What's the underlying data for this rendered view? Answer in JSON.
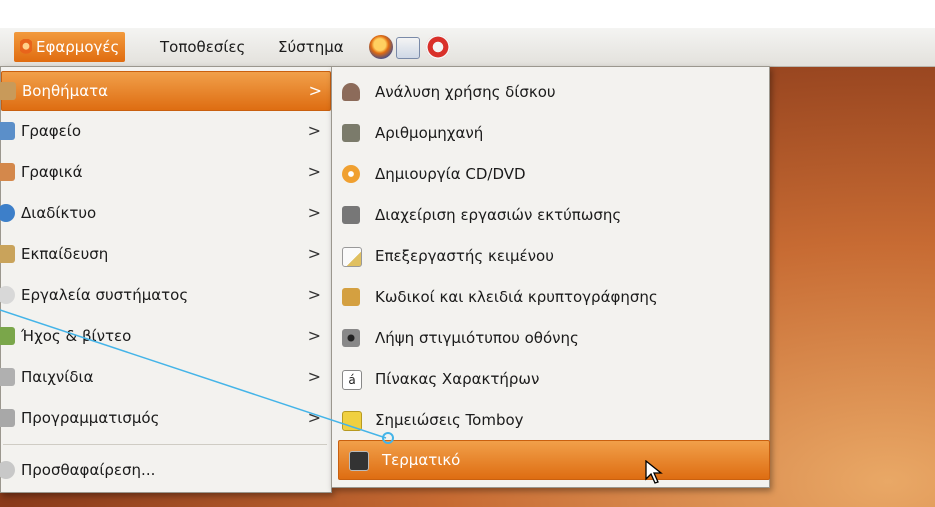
{
  "panel": {
    "menus": [
      "Εφαρμογές",
      "Τοποθεσίες",
      "Σύστημα"
    ],
    "launchers": [
      "firefox-icon",
      "mail-icon",
      "help-icon"
    ]
  },
  "apps_menu": {
    "items": [
      {
        "label": "Βοηθήματα",
        "icon": "accessories-icon",
        "color": "#c89a5a",
        "highlighted": true
      },
      {
        "label": "Γραφείο",
        "icon": "office-icon",
        "color": "#5b8fc9"
      },
      {
        "label": "Γραφικά",
        "icon": "graphics-icon",
        "color": "#d4884b"
      },
      {
        "label": "Διαδίκτυο",
        "icon": "internet-icon",
        "color": "#3d7fc9"
      },
      {
        "label": "Εκπαίδευση",
        "icon": "education-icon",
        "color": "#c9a35b"
      },
      {
        "label": "Εργαλεία συστήματος",
        "icon": "system-tools-icon",
        "color": "#b8b8b8"
      },
      {
        "label": "Ήχος & βίντεο",
        "icon": "sound-video-icon",
        "color": "#7aa64a"
      },
      {
        "label": "Παιχνίδια",
        "icon": "games-icon",
        "color": "#999999"
      },
      {
        "label": "Προγραμματισμός",
        "icon": "programming-icon",
        "color": "#999999"
      },
      {
        "label": "Προσθαφαίρεση...",
        "icon": "add-remove-icon",
        "color": "#888888"
      }
    ]
  },
  "accessories_menu": {
    "items": [
      {
        "label": "Ανάλυση χρήσης δίσκου",
        "icon": "disk-usage-icon",
        "color": "#8c6b5a"
      },
      {
        "label": "Αριθμομηχανή",
        "icon": "calculator-icon",
        "color": "#7b7b6b"
      },
      {
        "label": "Δημιουργία CD/DVD",
        "icon": "cd-burner-icon",
        "color": "#f0a030"
      },
      {
        "label": "Διαχείριση εργασιών εκτύπωσης",
        "icon": "printer-icon",
        "color": "#555555"
      },
      {
        "label": "Επεξεργαστής κειμένου",
        "icon": "text-editor-icon",
        "color": "#e0c060"
      },
      {
        "label": "Κωδικοί και κλειδιά κρυπτογράφησης",
        "icon": "keys-icon",
        "color": "#d4a040"
      },
      {
        "label": "Λήψη στιγμιότυπου οθόνης",
        "icon": "screenshot-icon",
        "color": "#555555"
      },
      {
        "label": "Πίνακας Χαρακτήρων",
        "icon": "character-map-icon",
        "color": "#ffffff",
        "glyph": "á"
      },
      {
        "label": "Σημειώσεις Tomboy",
        "icon": "tomboy-icon",
        "color": "#f0d040"
      },
      {
        "label": "Τερματικό",
        "icon": "terminal-icon",
        "color": "#333333",
        "highlighted": true
      }
    ]
  },
  "colors": {
    "highlight": "#e97c1f",
    "menu_bg": "#f3f2ef",
    "annotation": "#44b4e8"
  }
}
